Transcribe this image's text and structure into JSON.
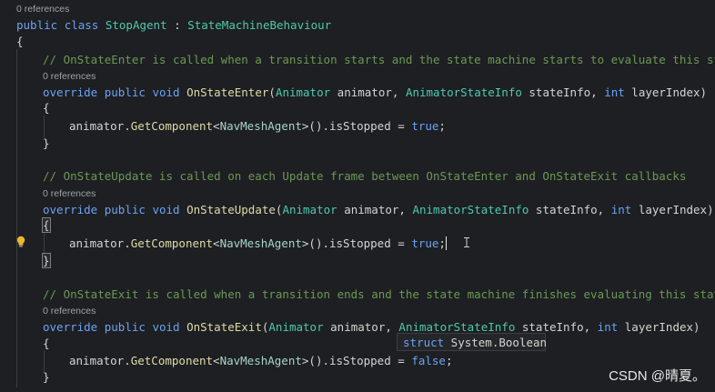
{
  "code": {
    "class_lens": "0 references",
    "class_decl": {
      "kw1": "public",
      "kw2": "class",
      "name": "StopAgent",
      "colon": " : ",
      "base": "StateMachineBehaviour"
    },
    "open_brace": "{",
    "close_brace": "}",
    "methods": [
      {
        "comment": "// OnStateEnter is called when a transition starts and the state machine starts to evaluate this state",
        "lens": "0 references",
        "sig": {
          "override": "override",
          "public": "public",
          "void": "void",
          "name": "OnStateEnter",
          "p1_type": "Animator",
          "p1_name": " animator, ",
          "p2_type": "AnimatorStateInfo",
          "p2_name": " stateInfo, ",
          "p3_type": "int",
          "p3_name": " layerIndex)"
        },
        "body": {
          "obj": "animator.",
          "call": "GetComponent",
          "lt": "<",
          "generic": "NavMeshAgent",
          "gt_rest": ">().isStopped = ",
          "value": "true",
          "end": ";"
        }
      },
      {
        "comment": "// OnStateUpdate is called on each Update frame between OnStateEnter and OnStateExit callbacks",
        "lens": "0 references",
        "sig": {
          "override": "override",
          "public": "public",
          "void": "void",
          "name": "OnStateUpdate",
          "p1_type": "Animator",
          "p1_name": " animator, ",
          "p2_type": "AnimatorStateInfo",
          "p2_name": " stateInfo, ",
          "p3_type": "int",
          "p3_name": " layerIndex)"
        },
        "body": {
          "obj": "animator.",
          "call": "GetComponent",
          "lt": "<",
          "generic": "NavMeshAgent",
          "gt_rest": ">().isStopped = ",
          "value": "true",
          "end": ";"
        }
      },
      {
        "comment": "// OnStateExit is called when a transition ends and the state machine finishes evaluating this state",
        "lens": "0 references",
        "sig": {
          "override": "override",
          "public": "public",
          "void": "void",
          "name": "OnStateExit",
          "p1_type": "Animator",
          "p1_name": " animator, ",
          "p2_type": "AnimatorStateInfo",
          "p2_name": " stateInfo, ",
          "p3_type": "int",
          "p3_name": " layerIndex)"
        },
        "body": {
          "obj": "animator.",
          "call": "GetComponent",
          "lt": "<",
          "generic": "NavMeshAgent",
          "gt_rest": ">().isStopped = ",
          "value": "false",
          "end": ";"
        }
      }
    ]
  },
  "tooltip": {
    "keyword": "struct",
    "type": " System.Boolean"
  },
  "watermark": "CSDN @晴夏。",
  "icons": {
    "lightbulb": "lightbulb-icon",
    "text_cursor": "text-cursor-icon"
  },
  "colors": {
    "background": "#1e1f22",
    "keyword": "#6aa3f5",
    "class": "#4ec9b0",
    "method": "#dcdcaa",
    "comment": "#6a9955",
    "plain": "#d4d4d4"
  }
}
